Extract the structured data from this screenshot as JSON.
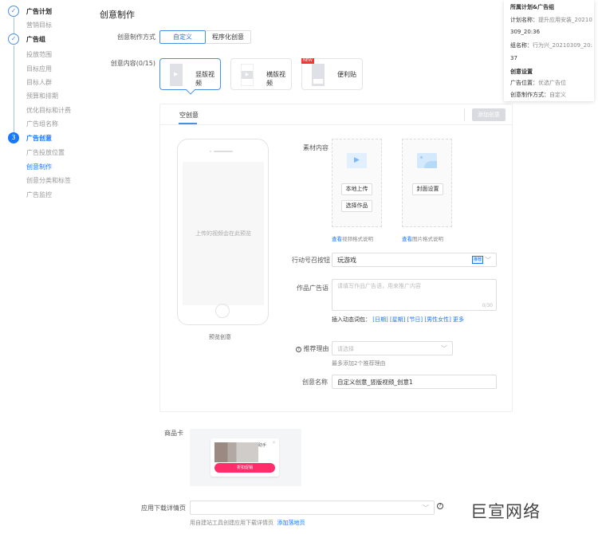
{
  "sidebar": {
    "items": [
      {
        "label": "广告计划"
      },
      {
        "label": "营销目标"
      },
      {
        "label": "广告组"
      },
      {
        "label": "投放范围"
      },
      {
        "label": "目标应用"
      },
      {
        "label": "目标人群"
      },
      {
        "label": "预算和排期"
      },
      {
        "label": "优化目标和计费"
      },
      {
        "label": "广告组名称"
      },
      {
        "label": "广告创意",
        "step": "3"
      },
      {
        "label": "广告投放位置"
      },
      {
        "label": "创意制作"
      },
      {
        "label": "创意分类和标签"
      },
      {
        "label": "广告监控"
      }
    ]
  },
  "page": {
    "title": "创意制作"
  },
  "mode": {
    "label": "创意制作方式",
    "options": [
      "自定义",
      "程序化创意"
    ],
    "selected": "自定义"
  },
  "content": {
    "label": "创意内容(0/15)",
    "cards": [
      {
        "label": "竖版视频"
      },
      {
        "label": "横版视频"
      },
      {
        "label": "便利贴",
        "badge": "NEW"
      }
    ]
  },
  "panel": {
    "tab": "空创意",
    "add_button": "添加创意"
  },
  "preview": {
    "screen_text": "上传的视频会在此预览",
    "caption": "预览创意"
  },
  "material": {
    "label": "素材内容",
    "upload_local": "本地上传",
    "choose_work": "选择作品",
    "cover_setting": "封面设置",
    "video_link_a": "查看",
    "video_link_b": "视频格式说明",
    "image_link_a": "查看",
    "image_link_b": "图片格式说明"
  },
  "cta": {
    "label": "行动号召按钮",
    "value": "玩游戏",
    "badge": "推荐"
  },
  "adtext": {
    "label": "作品广告语",
    "placeholder": "请填写作品广告语，用来推广内容",
    "counter": "0/30",
    "insert_label": "插入动态词包：",
    "words": [
      "[日期]",
      "[星期]",
      "[节日]",
      "[男性女性]"
    ],
    "more": "更多"
  },
  "reason": {
    "label": "推荐理由",
    "placeholder": "请选择",
    "hint": "最多添加2个推荐理由"
  },
  "name": {
    "label": "创意名称",
    "value": "自定义创意_竖版视频_创意1"
  },
  "product": {
    "label": "商品卡",
    "card_title": "助手",
    "card_button": "折扣促销"
  },
  "download": {
    "label": "应用下载详情页",
    "hint": "用自建站工具创建应用下载详情页",
    "link": "添加落地页"
  },
  "summary": {
    "title": "所属计划&广告组",
    "plan_label": "计划名称：",
    "plan_value_1": "提升应用安装_20210",
    "plan_value_2": "309_20:36",
    "group_label": "组名称：",
    "group_value_1": "行为兴_20210309_20:",
    "group_value_2": "37",
    "creative_title": "创意设置",
    "pos_label": "广告位置：",
    "pos_value": "优选广告位",
    "mode_label": "创意制作方式：",
    "mode_value": "自定义"
  },
  "watermark": "巨宣网络",
  "colors": {
    "accent": "#1677ff",
    "cta_pink": "#ff2d6a"
  }
}
